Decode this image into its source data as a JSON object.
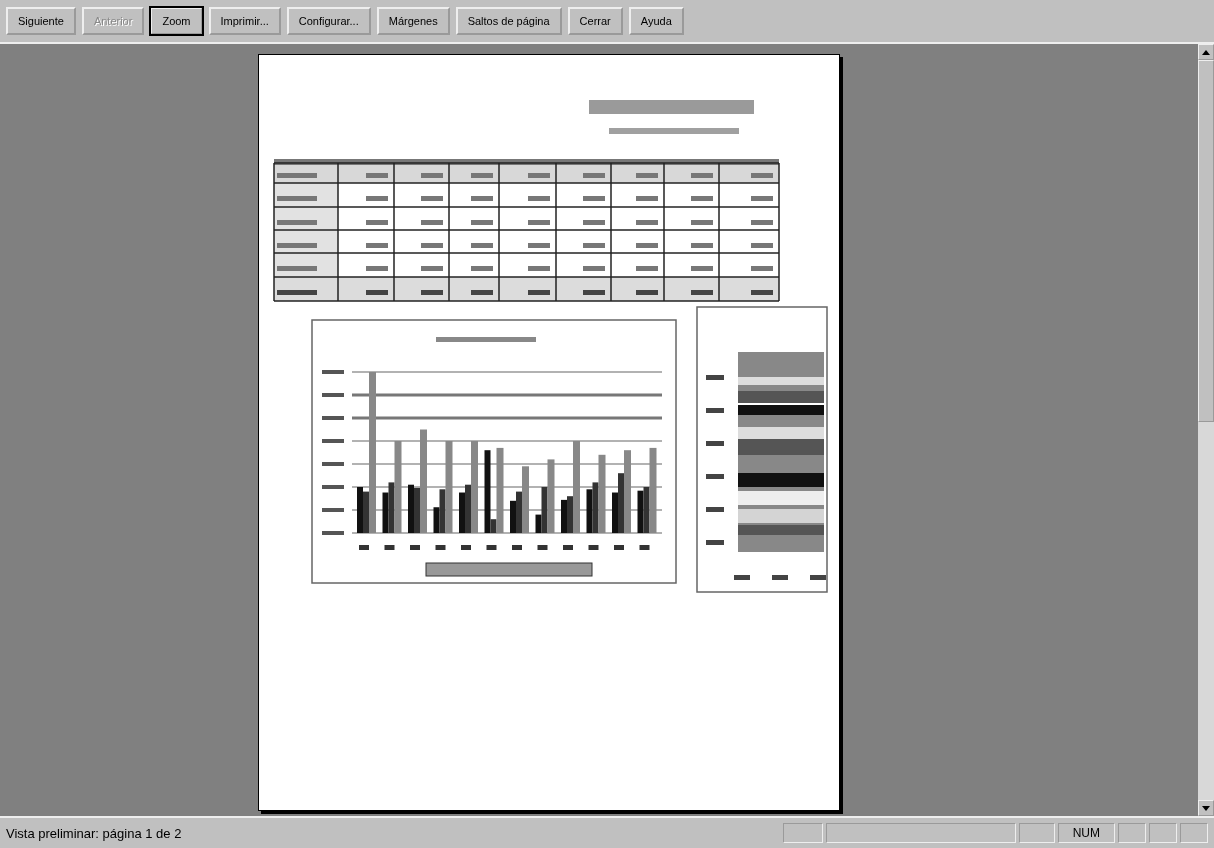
{
  "toolbar": {
    "buttons": [
      {
        "label": "Siguiente",
        "disabled": false,
        "focused": false
      },
      {
        "label": "Anterior",
        "disabled": true,
        "focused": false
      },
      {
        "label": "Zoom",
        "disabled": false,
        "focused": true
      },
      {
        "label": "Imprimir...",
        "disabled": false,
        "focused": false
      },
      {
        "label": "Configurar...",
        "disabled": false,
        "focused": false
      },
      {
        "label": "Márgenes",
        "disabled": false,
        "focused": false
      },
      {
        "label": "Saltos de página",
        "disabled": false,
        "focused": false
      },
      {
        "label": "Cerrar",
        "disabled": false,
        "focused": false
      },
      {
        "label": "Ayuda",
        "disabled": false,
        "focused": false
      }
    ]
  },
  "status_bar": {
    "message": "Vista preliminar: página 1 de 2",
    "indicator": "NUM"
  }
}
